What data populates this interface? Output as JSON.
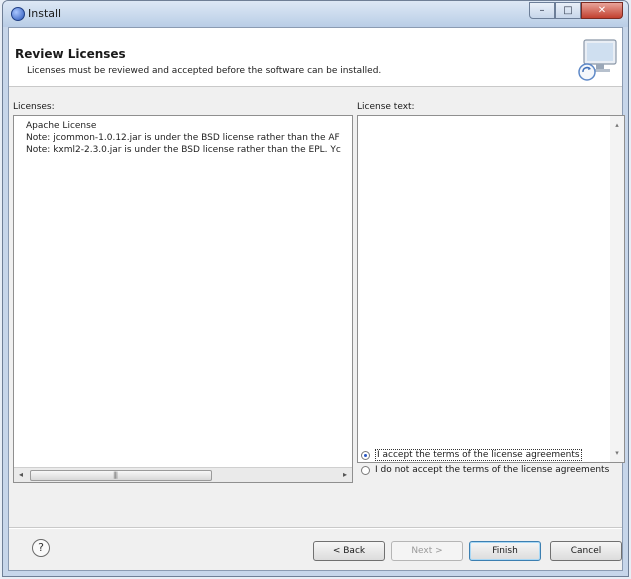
{
  "window": {
    "title": "Install",
    "minimize_icon": "minimize-icon",
    "maximize_icon": "maximize-icon",
    "close_icon": "close-icon"
  },
  "banner": {
    "title": "Review Licenses",
    "description": "Licenses must be reviewed and accepted before the software can be installed.",
    "graphic_icon": "computer-install-icon"
  },
  "licenses": {
    "label": "Licenses:",
    "items": [
      {
        "label": "Apache License"
      },
      {
        "label": "Note: jcommon-1.0.12.jar is under the BSD license rather than the AF"
      },
      {
        "label": "Note: kxml2-2.3.0.jar is under the BSD license rather than the EPL. Yc"
      }
    ]
  },
  "license_text": {
    "label": "License text:",
    "content": ""
  },
  "agreement": {
    "accept_label": "I accept the terms of the license agreements",
    "decline_label": "I do not accept the terms of the license agreements",
    "selected": "accept"
  },
  "buttons": {
    "help": "?",
    "back": "< Back",
    "next": "Next >",
    "finish": "Finish",
    "cancel": "Cancel"
  },
  "colors": {
    "titlebar": "#c7d6ea",
    "dialog_bg": "#f0f0f0",
    "close_button": "#c2402f"
  }
}
